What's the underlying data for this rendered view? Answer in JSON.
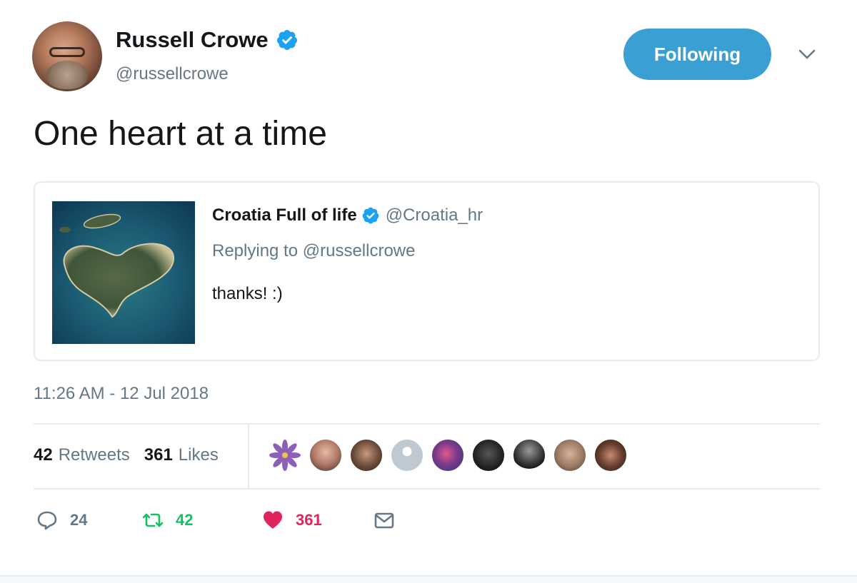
{
  "author": {
    "name": "Russell Crowe",
    "handle": "@russellcrowe"
  },
  "follow_button": {
    "label": "Following"
  },
  "tweet": {
    "text": "One heart at a time"
  },
  "quoted": {
    "name": "Croatia Full of life",
    "handle": "@Croatia_hr",
    "replying_to": "Replying to @russellcrowe",
    "text": "thanks! :)"
  },
  "timestamp": "11:26 AM - 12 Jul 2018",
  "stats": {
    "retweets_count": "42",
    "retweets_label": "Retweets",
    "likes_count": "361",
    "likes_label": "Likes"
  },
  "actions": {
    "reply_count": "24",
    "retweet_count": "42",
    "like_count": "361"
  },
  "colors": {
    "accent": "#3aa0d3",
    "retweet": "#17bf63",
    "like": "#e0245e",
    "secondary_text": "#657786"
  },
  "icons": [
    "verified-icon",
    "chevron-down-icon",
    "reply-icon",
    "retweet-icon",
    "heart-icon",
    "mail-icon"
  ]
}
